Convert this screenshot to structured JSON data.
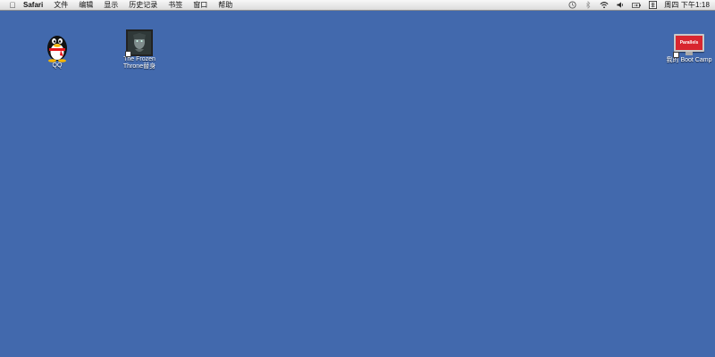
{
  "menubar": {
    "app_name": "Safari",
    "items": [
      "文件",
      "编辑",
      "显示",
      "历史记录",
      "书签",
      "窗口",
      "帮助"
    ],
    "clock": "周四 下午1:18"
  },
  "desktop": {
    "icons": [
      {
        "label_line1": "QQ",
        "label_line2": ""
      },
      {
        "label_line1": "The Frozen",
        "label_line2": "Throne替身"
      },
      {
        "label_line1": "我的 Boot Camp",
        "label_line2": ""
      }
    ],
    "parallels_logo_text": "Parallels"
  },
  "colors": {
    "desktop_background": "#4269ad",
    "menubar_background": "#efefef",
    "parallels_red": "#d8262f"
  }
}
